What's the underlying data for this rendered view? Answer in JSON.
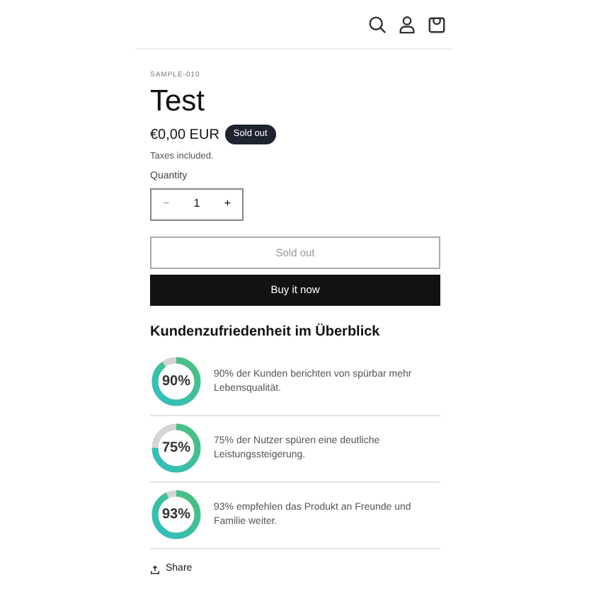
{
  "product": {
    "vendor": "SAMPLE-010",
    "title": "Test",
    "price": "€0,00 EUR",
    "badge": "Sold out",
    "tax_note": "Taxes included."
  },
  "quantity": {
    "label": "Quantity",
    "minus": "−",
    "value": "1",
    "plus": "+"
  },
  "buttons": {
    "sold_out": {
      "label": "Sold out",
      "disabled": true
    },
    "buy_now": {
      "label": "Buy it now"
    }
  },
  "stats": {
    "heading": "Kundenzufriedenheit im Überblick",
    "items": [
      {
        "label": "90%",
        "text": "90% der Kunden berichten von spürbar mehr Lebensqualität."
      },
      {
        "label": "75%",
        "text": "75% der Nutzer spüren eine deutliche Leistungssteigerung."
      },
      {
        "label": "93%",
        "text": "93% empfehlen das Produkt an Freunde und Familie weiter."
      }
    ]
  },
  "share": {
    "label": "Share"
  }
}
